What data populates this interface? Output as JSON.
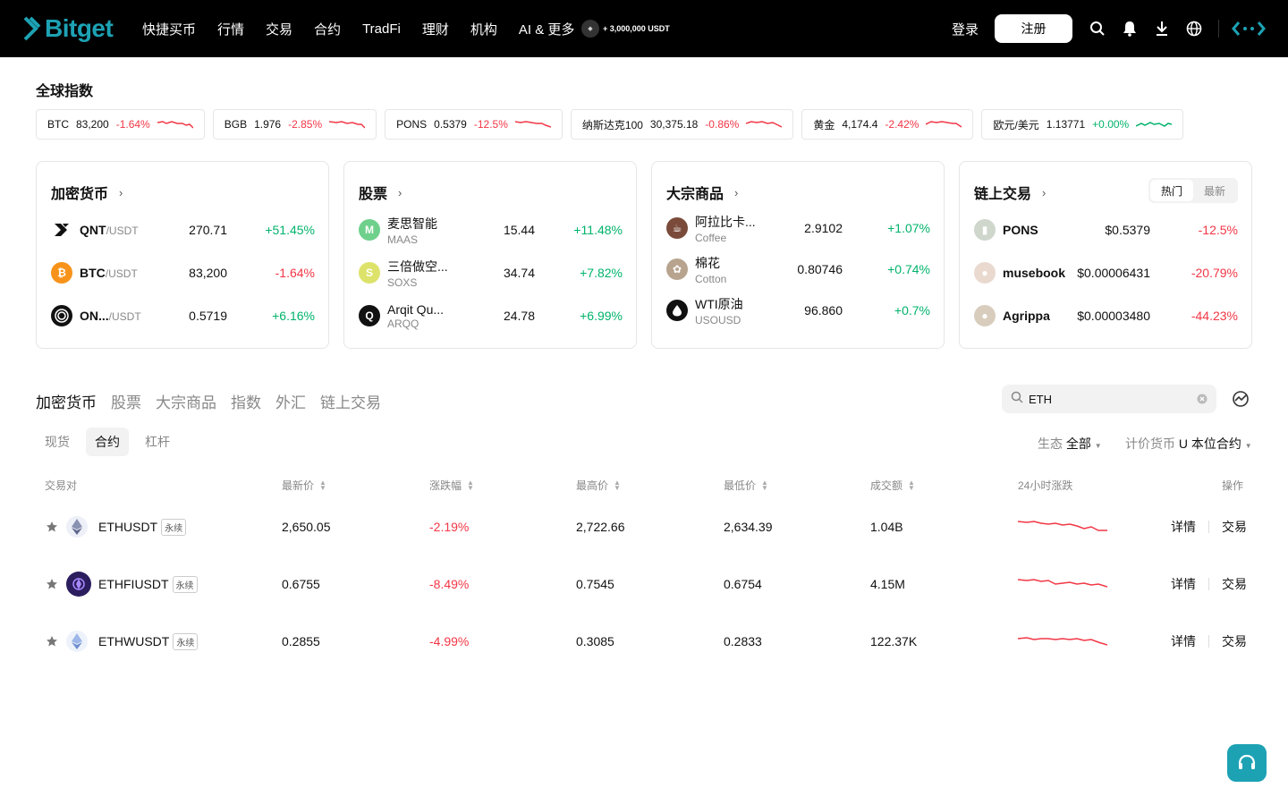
{
  "header": {
    "brand": "Bitget",
    "nav": [
      "快捷买币",
      "行情",
      "交易",
      "合约",
      "TradFi",
      "理财",
      "机构",
      "AI & 更多"
    ],
    "promo": "+ 3,000,000 USDT",
    "login": "登录",
    "register": "注册"
  },
  "global_index": {
    "title": "全球指数",
    "items": [
      {
        "name": "BTC",
        "price": "83,200",
        "change": "-1.64%",
        "trend": "down"
      },
      {
        "name": "BGB",
        "price": "1.976",
        "change": "-2.85%",
        "trend": "down"
      },
      {
        "name": "PONS",
        "price": "0.5379",
        "change": "-12.5%",
        "trend": "down"
      },
      {
        "name": "纳斯达克100",
        "price": "30,375.18",
        "change": "-0.86%",
        "trend": "down"
      },
      {
        "name": "黄金",
        "price": "4,174.4",
        "change": "-2.42%",
        "trend": "down"
      },
      {
        "name": "欧元/美元",
        "price": "1.13771",
        "change": "+0.00%",
        "trend": "flat"
      }
    ]
  },
  "cards": {
    "crypto": {
      "title": "加密货币",
      "rows": [
        {
          "base": "QNT",
          "quote": "/USDT",
          "price": "270.71",
          "change": "+51.45%"
        },
        {
          "base": "BTC",
          "quote": "/USDT",
          "price": "83,200",
          "change": "-1.64%"
        },
        {
          "base": "ON...",
          "quote": "/USDT",
          "price": "0.5719",
          "change": "+6.16%"
        }
      ]
    },
    "stocks": {
      "title": "股票",
      "rows": [
        {
          "name": "麦思智能",
          "sub": "MAAS",
          "icon": "M",
          "price": "15.44",
          "change": "+11.48%"
        },
        {
          "name": "三倍做空...",
          "sub": "SOXS",
          "icon": "S",
          "price": "34.74",
          "change": "+7.82%"
        },
        {
          "name": "Arqit Qu...",
          "sub": "ARQQ",
          "icon": "Q",
          "price": "24.78",
          "change": "+6.99%"
        }
      ]
    },
    "commodities": {
      "title": "大宗商品",
      "rows": [
        {
          "name": "阿拉比卡...",
          "sub": "Coffee",
          "price": "2.9102",
          "change": "+1.07%"
        },
        {
          "name": "棉花",
          "sub": "Cotton",
          "price": "0.80746",
          "change": "+0.74%"
        },
        {
          "name": "WTI原油",
          "sub": "USOUSD",
          "price": "96.860",
          "change": "+0.7%"
        }
      ]
    },
    "onchain": {
      "title": "链上交易",
      "seg": [
        "热门",
        "最新"
      ],
      "rows": [
        {
          "name": "PONS",
          "price": "$0.5379",
          "change": "-12.5%"
        },
        {
          "name": "musebook",
          "price": "$0.00006431",
          "change": "-20.79%"
        },
        {
          "name": "Agrippa",
          "price": "$0.00003480",
          "change": "-44.23%"
        }
      ]
    }
  },
  "market": {
    "tabs": [
      "加密货币",
      "股票",
      "大宗商品",
      "指数",
      "外汇",
      "链上交易"
    ],
    "search_value": "ETH",
    "subtabs": [
      "现货",
      "合约",
      "杠杆"
    ],
    "filter_eco_label": "生态",
    "filter_eco_value": "全部",
    "filter_quote_label": "计价货币",
    "filter_quote_value": "U 本位合约",
    "columns": [
      "交易对",
      "最新价",
      "涨跌幅",
      "最高价",
      "最低价",
      "成交额",
      "24小时涨跌",
      "操作"
    ],
    "rows": [
      {
        "pair": "ETHUSDT",
        "tag": "永续",
        "last": "2,650.05",
        "change": "-2.19%",
        "high": "2,722.66",
        "low": "2,634.39",
        "volume": "1.04B"
      },
      {
        "pair": "ETHFIUSDT",
        "tag": "永续",
        "last": "0.6755",
        "change": "-8.49%",
        "high": "0.7545",
        "low": "0.6754",
        "volume": "4.15M"
      },
      {
        "pair": "ETHWUSDT",
        "tag": "永续",
        "last": "0.2855",
        "change": "-4.99%",
        "high": "0.3085",
        "low": "0.2833",
        "volume": "122.37K"
      }
    ],
    "action_detail": "详情",
    "action_trade": "交易"
  },
  "colors": {
    "accent": "#1da2b4",
    "up": "#00b36b",
    "down": "#f23645"
  }
}
